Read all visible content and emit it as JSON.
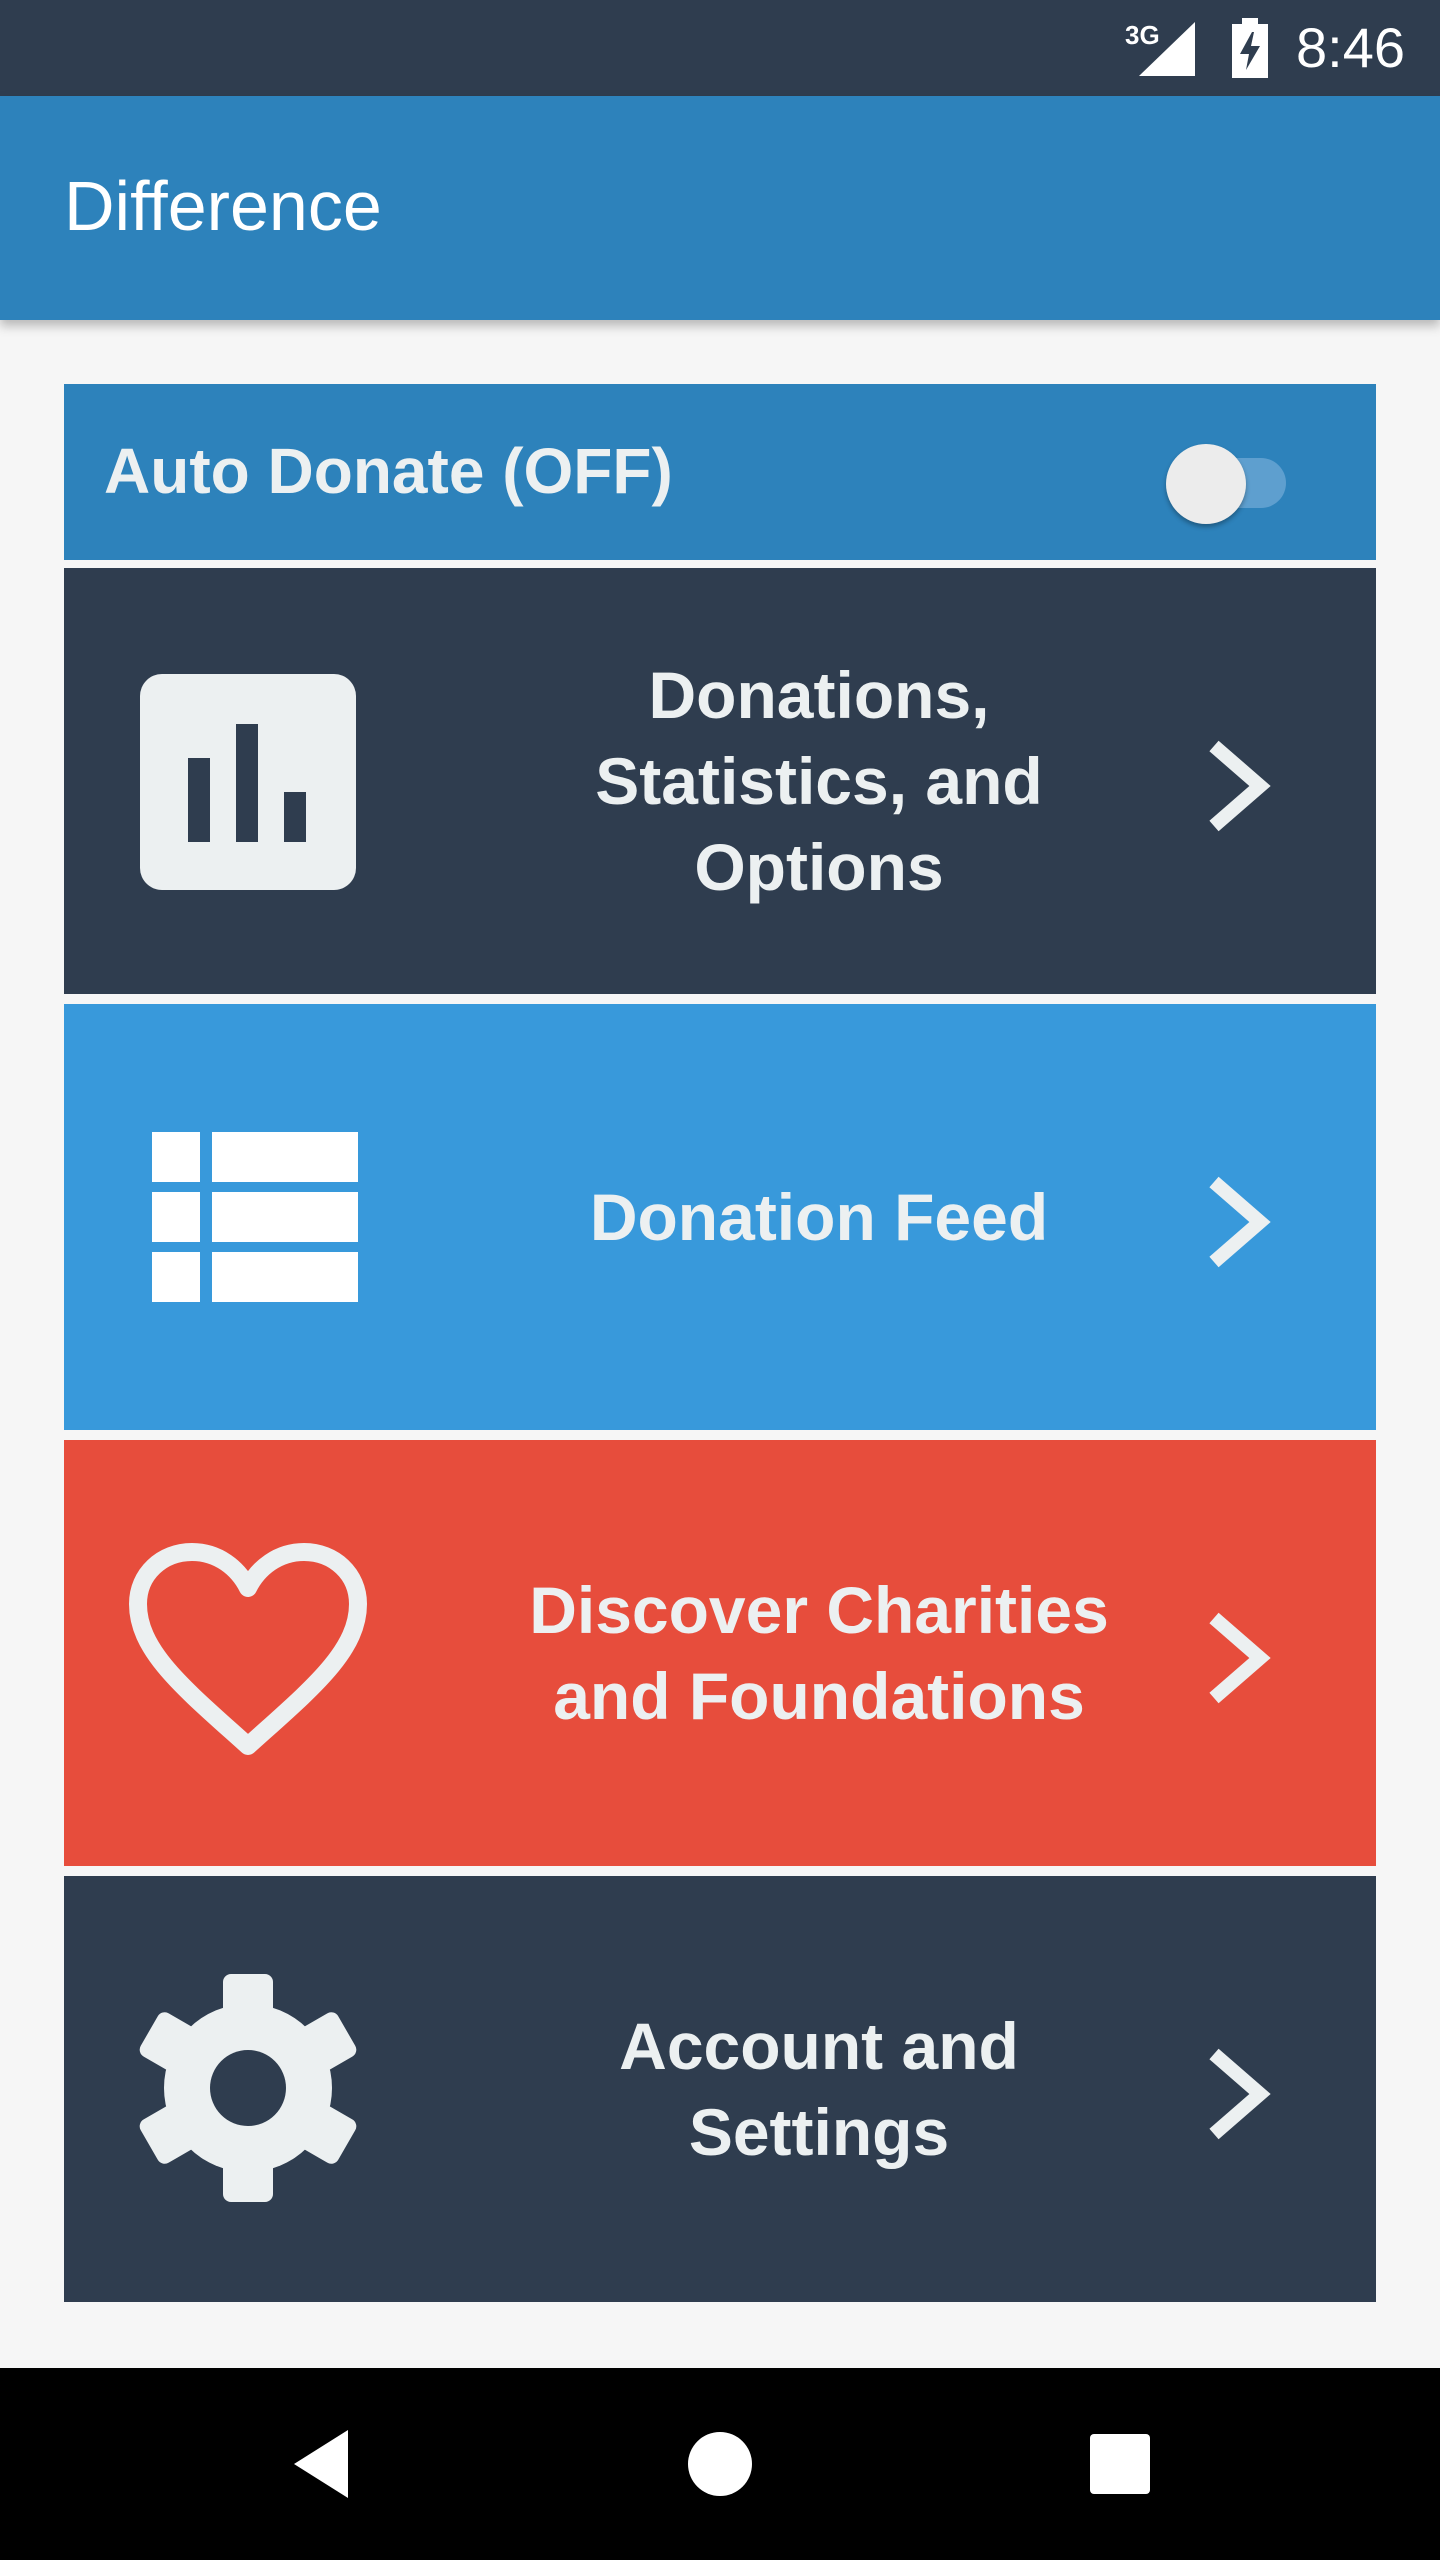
{
  "status_bar": {
    "network": "3G",
    "time": "8:46"
  },
  "app_bar": {
    "title": "Difference"
  },
  "auto_donate": {
    "label": "Auto Donate (OFF)",
    "enabled": false
  },
  "menu": [
    {
      "label": "Donations, Statistics, and Options",
      "icon": "bar-chart-icon",
      "color": "#2f3d4f"
    },
    {
      "label": "Donation Feed",
      "icon": "list-icon",
      "color": "#3899db"
    },
    {
      "label": "Discover Charities and Foundations",
      "icon": "heart-icon",
      "color": "#e74d3c"
    },
    {
      "label": "Account and Settings",
      "icon": "gear-icon",
      "color": "#2f3d4f"
    }
  ],
  "nav_bar": {
    "back": "back-icon",
    "home": "home-icon",
    "recent": "recent-apps-icon"
  }
}
